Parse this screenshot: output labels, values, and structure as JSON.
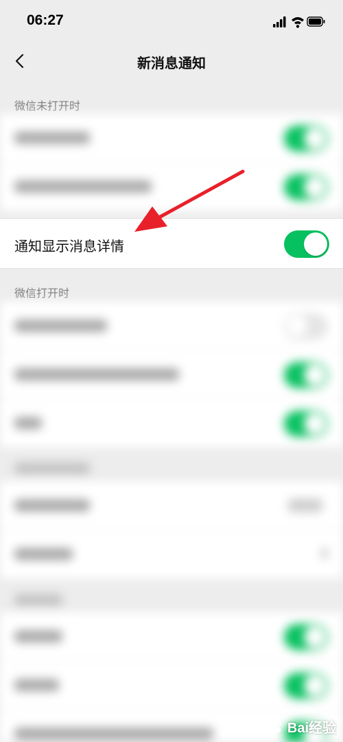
{
  "status_bar": {
    "time": "06:27"
  },
  "nav": {
    "title": "新消息通知"
  },
  "sections": {
    "closed_header": "微信未打开时",
    "open_header": "微信打开时"
  },
  "highlight": {
    "label": "通知显示消息详情",
    "toggle_on": true
  },
  "colors": {
    "toggle_on": "#07c160",
    "background": "#ededed",
    "arrow": "#e8202a"
  },
  "icons": [
    "back-icon",
    "signal-icon",
    "wifi-icon",
    "battery-icon",
    "baidu-paw-icon"
  ],
  "watermark": {
    "text": "Bai经验"
  }
}
